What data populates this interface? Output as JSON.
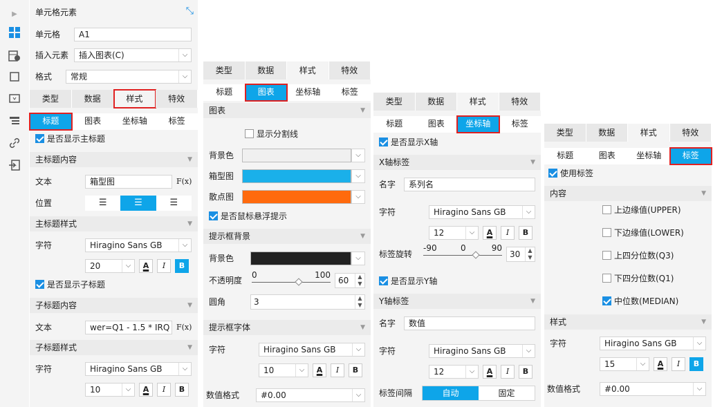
{
  "p1": {
    "title": "单元格元素",
    "cell_label": "单元格",
    "cell_value": "A1",
    "insert_label": "插入元素",
    "insert_value": "插入图表(C)",
    "format_label": "格式",
    "format_value": "常规",
    "tabs": [
      "类型",
      "数据",
      "样式",
      "特效"
    ],
    "subtabs": [
      "标题",
      "图表",
      "坐标轴",
      "标签"
    ],
    "show_main": "是否显示主标题",
    "main_content": "主标题内容",
    "text_label": "文本",
    "main_text": "箱型图",
    "pos_label": "位置",
    "main_style": "主标题样式",
    "char_label": "字符",
    "font": "Hiragino Sans GB",
    "size": "20",
    "show_sub": "是否显示子标题",
    "sub_content": "子标题内容",
    "sub_text": "wer=Q1 - 1.5 * IRQ",
    "sub_style": "子标题样式",
    "sub_size": "10",
    "fx": "F(x)"
  },
  "p2": {
    "tabs": [
      "类型",
      "数据",
      "样式",
      "特效"
    ],
    "subtabs": [
      "标题",
      "图表",
      "坐标轴",
      "标签"
    ],
    "section": "图表",
    "gridline": "显示分割线",
    "bg_label": "背景色",
    "box_label": "箱型图",
    "scatter_label": "散点图",
    "hover": "是否鼠标悬浮提示",
    "tip_bg": "提示框背景",
    "bg_label2": "背景色",
    "opacity_label": "不透明度",
    "op_min": "0",
    "op_max": "100",
    "op_val": "60",
    "radius_label": "圆角",
    "radius_val": "3",
    "tip_font": "提示框字体",
    "char_label": "字符",
    "font": "Hiragino Sans GB",
    "size": "10",
    "num_label": "数值格式",
    "num_val": "#0.00",
    "colors": {
      "bg": "#f0f0f0",
      "box": "#1ab0ea",
      "scatter": "#ff6a0d",
      "tip": "#222222"
    }
  },
  "p3": {
    "tabs": [
      "类型",
      "数据",
      "样式",
      "特效"
    ],
    "subtabs": [
      "标题",
      "图表",
      "坐标轴",
      "标签"
    ],
    "show_x": "是否显示X轴",
    "x_label": "X轴标签",
    "name_label": "名字",
    "x_name": "系列名",
    "char_label": "字符",
    "font": "Hiragino Sans GB",
    "size": "12",
    "rot_label": "标签旋转",
    "rot_min": "-90",
    "rot_mid": "0",
    "rot_max": "90",
    "rot_val": "30",
    "show_y": "是否显示Y轴",
    "y_label": "Y轴标签",
    "y_name": "数值",
    "size2": "12",
    "gap_label": "标签间隔",
    "auto": "自动",
    "fixed": "固定"
  },
  "p4": {
    "tabs": [
      "类型",
      "数据",
      "样式",
      "特效"
    ],
    "subtabs": [
      "标题",
      "图表",
      "坐标轴",
      "标签"
    ],
    "use_label": "使用标签",
    "content": "内容",
    "items": [
      "上边缘值(UPPER)",
      "下边缘值(LOWER)",
      "上四分位数(Q3)",
      "下四分位数(Q1)",
      "中位数(MEDIAN)"
    ],
    "style": "样式",
    "char_label": "字符",
    "font": "Hiragino Sans GB",
    "size": "15",
    "num_label": "数值格式",
    "num_val": "#0.00"
  }
}
